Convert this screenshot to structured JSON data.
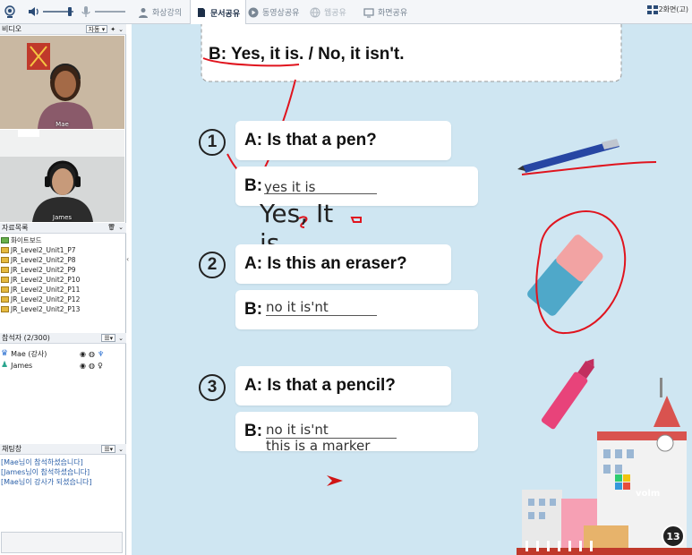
{
  "toolbar": {
    "tabs": [
      {
        "label": "화상강의",
        "state": "normal"
      },
      {
        "label": "문서공유",
        "state": "active"
      },
      {
        "label": "동영상공유",
        "state": "normal"
      },
      {
        "label": "웹공유",
        "state": "disabled"
      },
      {
        "label": "화면공유",
        "state": "normal"
      }
    ],
    "screen_label": "2화면(고)"
  },
  "video": {
    "title": "비디오",
    "mode": "자동",
    "participants": [
      {
        "name": "Mae"
      },
      {
        "name": "James"
      }
    ]
  },
  "files": {
    "title": "자료목록",
    "items": [
      "화이트보드",
      "JR_Level2_Unit1_P7",
      "JR_Level2_Unit2_P8",
      "JR_Level2_Unit2_P9",
      "JR_Level2_Unit2_P10",
      "JR_Level2_Unit2_P11",
      "JR_Level2_Unit2_P12",
      "JR_Level2_Unit2_P13"
    ]
  },
  "attendees": {
    "title": "참석자 (2/300)",
    "list": [
      {
        "name": "Mae (강사)",
        "role": "teacher"
      },
      {
        "name": "James",
        "role": "student"
      }
    ]
  },
  "chat": {
    "title": "채팅창",
    "messages": [
      "[Mae님이 참석하셨습니다]",
      "[James님이 참석하셨습니다]",
      "[Mae님이 강사가 되셨습니다]"
    ]
  },
  "slide": {
    "example_b": "B: Yes, it is. / No, it isn't.",
    "questions": [
      {
        "num": "1",
        "a": "A: Is that a pen?",
        "b_label": "B:",
        "answer": "yes it is"
      },
      {
        "num": "2",
        "a": "A: Is this an eraser?",
        "b_label": "B:",
        "answer": "no it is'nt"
      },
      {
        "num": "3",
        "a": "A: Is that a pencil?",
        "b_label": "B:",
        "answer": "no it is'nt",
        "answer2": "this is a marker"
      }
    ],
    "big_text": "Yes, It is.",
    "logo": "volm",
    "page": "13"
  },
  "colors": {
    "annotation": "#e0141e",
    "slide_bg": "#cfe6f2",
    "toolbar_bg": "#f4f6f9"
  }
}
